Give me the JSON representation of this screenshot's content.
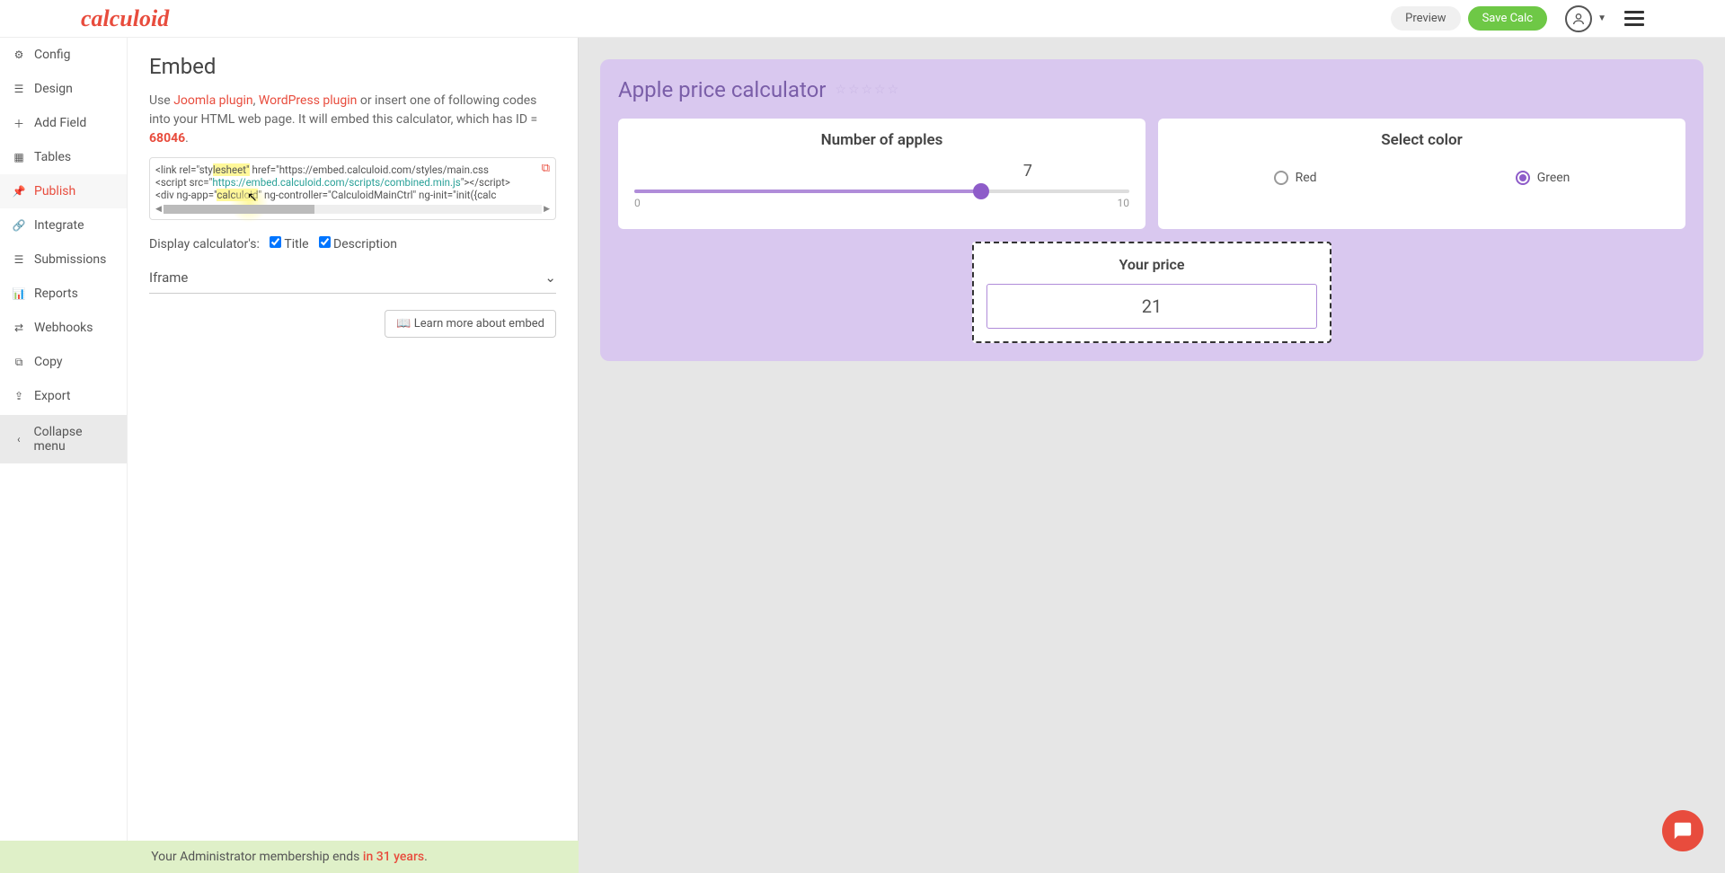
{
  "header": {
    "logo": "calculoid",
    "preview": "Preview",
    "save": "Save Calc"
  },
  "sidebar": {
    "items": [
      {
        "label": "Config"
      },
      {
        "label": "Design"
      },
      {
        "label": "Add Field"
      },
      {
        "label": "Tables"
      },
      {
        "label": "Publish"
      },
      {
        "label": "Integrate"
      },
      {
        "label": "Submissions"
      },
      {
        "label": "Reports"
      },
      {
        "label": "Webhooks"
      },
      {
        "label": "Copy"
      },
      {
        "label": "Export"
      }
    ],
    "collapse": "Collapse menu"
  },
  "embed": {
    "title": "Embed",
    "desc_prefix": "Use ",
    "joomla": "Joomla plugin",
    "comma": ", ",
    "wordpress": "WordPress plugin",
    "desc_mid": " or insert one of following codes into your HTML web page. It will embed this calculator, which has ID = ",
    "id": "68046",
    "code_line1a": "<link rel=\"sty",
    "code_line1_hl": "lesheet\"",
    "code_line1b": " href=\"https://embed.calculoid.com/styles/main.css",
    "code_line2a": "<script src=\"",
    "code_line2_str": "https://embed.calculoid.com/scripts/combined.min.js",
    "code_line2b": "\"></script>",
    "code_line3a": "<div ng-app=\"",
    "code_line3_hl": "calculoid",
    "code_line3b": "\" ng-controller=\"CalculoidMainCtrl\" ng-init=\"init({calc",
    "display_label": "Display calculator's:",
    "title_cb": "Title",
    "desc_cb": "Description",
    "iframe_label": "Iframe",
    "learn_more": "Learn more about embed"
  },
  "footer": {
    "prefix": "Your Administrator membership ends ",
    "years": "in 31 years",
    "suffix": "."
  },
  "calculator": {
    "title": "Apple price calculator",
    "apples_label": "Number of apples",
    "apples_value": "7",
    "apples_min": "0",
    "apples_max": "10",
    "color_label": "Select color",
    "red": "Red",
    "green": "Green",
    "price_label": "Your price",
    "price_value": "21"
  }
}
